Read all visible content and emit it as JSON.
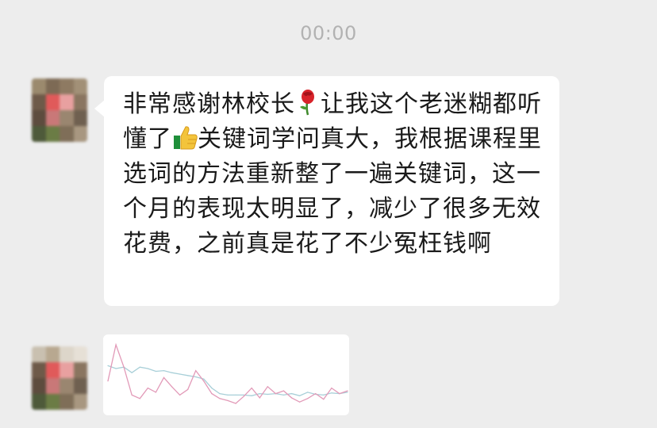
{
  "timestamp": "00:00",
  "message_1": {
    "segments": [
      {
        "type": "text",
        "value": "非常感谢林校长"
      },
      {
        "type": "emoji",
        "name": "rose-icon"
      },
      {
        "type": "text",
        "value": "让我这个老迷糊都听懂了"
      },
      {
        "type": "emoji",
        "name": "thumbs-up-icon"
      },
      {
        "type": "text",
        "value": "关键词学问真大，我根据课程里选词的方法重新整了一遍关键词，这一个月的表现太明显了，减少了很多无效花费，之前真是花了不少冤枉钱啊"
      }
    ]
  },
  "avatar_colors": [
    [
      "#9b8a6e",
      "#7d6a55",
      "#8e7a62",
      "#a29077"
    ],
    [
      "#6e5a49",
      "#e05a5a",
      "#e8a0a0",
      "#8a7560"
    ],
    [
      "#5d4c3e",
      "#c97878",
      "#9a8670",
      "#6f6050"
    ],
    [
      "#4e5a3a",
      "#6b7c45",
      "#7f6e58",
      "#a89780"
    ]
  ],
  "avatar2_colors": [
    [
      "#c9c0b0",
      "#b8a890",
      "#ddd6ca",
      "#e6e0d6"
    ],
    [
      "#6e5a49",
      "#e05a5a",
      "#e8a0a0",
      "#8a7560"
    ],
    [
      "#5d4c3e",
      "#c97878",
      "#9a8670",
      "#6f6050"
    ],
    [
      "#4e5a3a",
      "#6b7c45",
      "#7f6e58",
      "#a89780"
    ]
  ],
  "chart_data": {
    "type": "line",
    "x": [
      0,
      1,
      2,
      3,
      4,
      5,
      6,
      7,
      8,
      9,
      10,
      11,
      12,
      13,
      14,
      15,
      16,
      17,
      18,
      19,
      20,
      21,
      22,
      23,
      24,
      25,
      26,
      27,
      28,
      29,
      30
    ],
    "series": [
      {
        "color": "#a8cfd8",
        "values": [
          62,
          58,
          60,
          52,
          60,
          58,
          54,
          55,
          52,
          50,
          48,
          46,
          43,
          30,
          22,
          20,
          20,
          20,
          19,
          22,
          21,
          22,
          20,
          22,
          19,
          24,
          21,
          20,
          23,
          22,
          24
        ]
      },
      {
        "color": "#e29ab8",
        "values": [
          40,
          92,
          60,
          20,
          15,
          30,
          24,
          45,
          32,
          20,
          28,
          55,
          40,
          22,
          15,
          12,
          8,
          18,
          30,
          16,
          32,
          22,
          26,
          16,
          10,
          15,
          22,
          14,
          30,
          22,
          26
        ]
      }
    ],
    "ylim": [
      0,
      100
    ]
  }
}
